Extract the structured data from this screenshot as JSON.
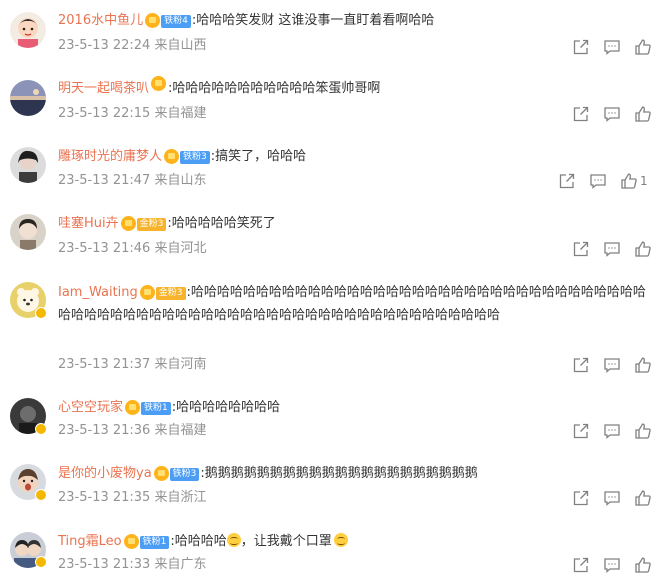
{
  "comments": [
    {
      "username": "2016水中鱼儿",
      "fan_badge": {
        "type": "tie",
        "label": "铁粉4"
      },
      "text": ":哈哈哈笑发财 这谁没事一直盯着看啊哈哈",
      "time": "23-5-13 22:24",
      "location": "来自山西",
      "likes": ""
    },
    {
      "username": "明天一起喝茶叭",
      "fan_badge": {
        "type": "crown",
        "label": ""
      },
      "text": ":哈哈哈哈哈哈哈哈哈哈哈笨蛋帅哥啊",
      "time": "23-5-13 22:15",
      "location": "来自福建",
      "likes": ""
    },
    {
      "username": "雕琢时光的庸梦人",
      "fan_badge": {
        "type": "tie",
        "label": "铁粉3"
      },
      "text": ":搞笑了，哈哈哈",
      "time": "23-5-13 21:47",
      "location": "来自山东",
      "likes": "1"
    },
    {
      "username": "哇塞Hui卉",
      "fan_badge": {
        "type": "jin",
        "label": "金粉3"
      },
      "text": ":哈哈哈哈哈笑死了",
      "time": "23-5-13 21:46",
      "location": "来自河北",
      "likes": ""
    },
    {
      "username": "Iam_Waiting",
      "fan_badge": {
        "type": "jin",
        "label": "金粉3"
      },
      "text": ":哈哈哈哈哈哈哈哈哈哈哈哈哈哈哈哈哈哈哈哈哈哈哈哈哈哈哈哈哈哈哈哈哈哈哈哈哈哈哈哈哈哈哈哈哈哈哈哈哈哈哈哈哈哈哈哈哈哈哈哈哈哈哈哈哈哈哈哈哈",
      "time": "23-5-13 21:37",
      "location": "来自河南",
      "likes": ""
    },
    {
      "username": "心空空玩家",
      "fan_badge": {
        "type": "tie",
        "label": "铁粉1"
      },
      "text": ":哈哈哈哈哈哈哈哈",
      "time": "23-5-13 21:36",
      "location": "来自福建",
      "likes": ""
    },
    {
      "username": "是你的小废物ya",
      "fan_badge": {
        "type": "tie",
        "label": "铁粉3"
      },
      "text": ":鹅鹅鹅鹅鹅鹅鹅鹅鹅鹅鹅鹅鹅鹅鹅鹅鹅鹅鹅鹅鹅",
      "time": "23-5-13 21:35",
      "location": "来自浙江",
      "likes": ""
    },
    {
      "username": "Ting霜Leo",
      "fan_badge": {
        "type": "tie",
        "label": "铁粉1"
      },
      "text": ":哈哈哈哈",
      "text_after_emoji": "，让我戴个口罩",
      "time": "23-5-13 21:33",
      "location": "来自广东",
      "likes": ""
    }
  ],
  "icons": {
    "share": "share-icon",
    "comment": "comment-icon",
    "like": "thumbs-up-icon"
  },
  "colors": {
    "username": "#eb7350",
    "meta": "#939393",
    "text": "#333333",
    "tie_badge": "#4c9ef5",
    "jin_badge": "#f7b32b",
    "verified": "#f5b800"
  }
}
